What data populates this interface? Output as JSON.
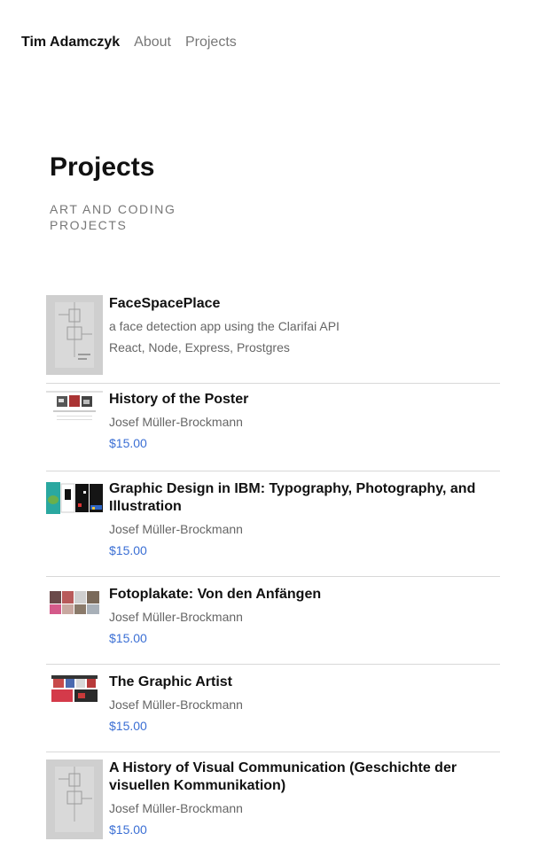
{
  "nav": {
    "brand": "Tim Adamczyk",
    "links": [
      "About",
      "Projects"
    ]
  },
  "header": {
    "title": "Projects",
    "subtitle": "ART AND CODING PROJECTS"
  },
  "projects": [
    {
      "title": "FaceSpacePlace",
      "description": "a face detection app using the Clarifai API",
      "stack": "React, Node, Express, Prostgres"
    },
    {
      "title": "History of the Poster",
      "author": "Josef Müller-Brockmann",
      "price": "$15.00"
    },
    {
      "title": "Graphic Design in IBM: Typography, Photography, and Illustration",
      "author": "Josef Müller-Brockmann",
      "price": "$15.00"
    },
    {
      "title": "Fotoplakate: Von den Anfängen",
      "author": "Josef Müller-Brockmann",
      "price": "$15.00"
    },
    {
      "title": "The Graphic Artist",
      "author": "Josef Müller-Brockmann",
      "price": "$15.00"
    },
    {
      "title": "A History of Visual Communication (Geschichte der visuellen Kommunikation)",
      "author": "Josef Müller-Brockmann",
      "price": "$15.00"
    }
  ]
}
